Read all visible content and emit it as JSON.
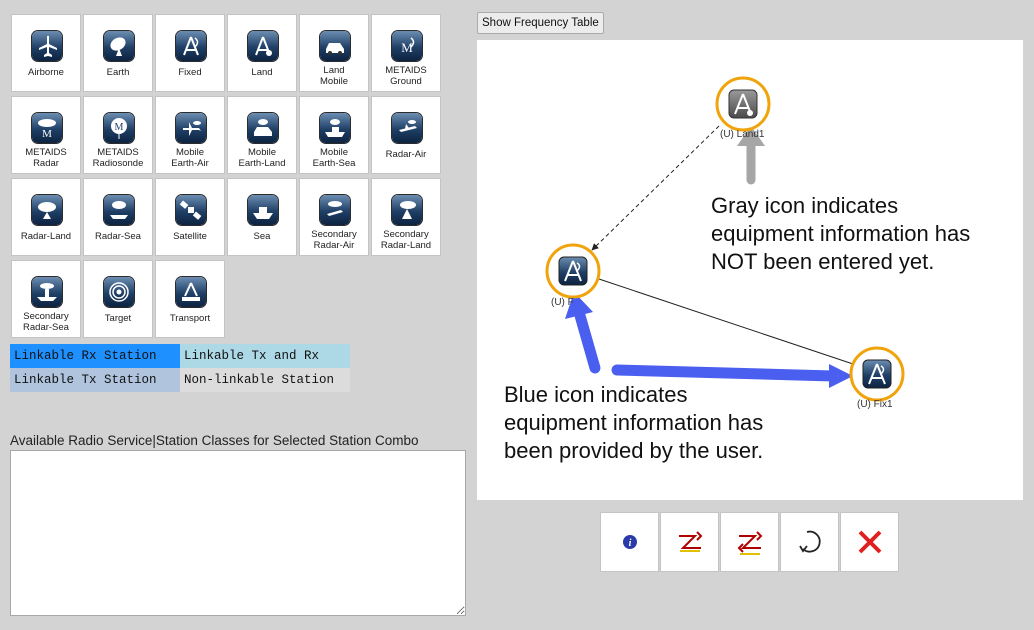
{
  "palette": {
    "stations": [
      {
        "label": "Airborne",
        "icon": "airplane-icon"
      },
      {
        "label": "Earth",
        "icon": "satellite-dish-icon"
      },
      {
        "label": "Fixed",
        "icon": "fixed-tower-icon"
      },
      {
        "label": "Land",
        "icon": "land-tower-icon"
      },
      {
        "label": "Land\nMobile",
        "icon": "car-icon"
      },
      {
        "label": "METAIDS\nGround",
        "icon": "metaids-ground-icon"
      },
      {
        "label": "METAIDS\nRadar",
        "icon": "metaids-radar-icon"
      },
      {
        "label": "METAIDS\nRadiosonde",
        "icon": "radiosonde-balloon-icon"
      },
      {
        "label": "Mobile\nEarth-Air",
        "icon": "mobile-earth-air-icon"
      },
      {
        "label": "Mobile\nEarth-Land",
        "icon": "mobile-earth-land-icon"
      },
      {
        "label": "Mobile\nEarth-Sea",
        "icon": "mobile-earth-sea-icon"
      },
      {
        "label": "Radar-Air",
        "icon": "radar-air-icon"
      },
      {
        "label": "Radar-Land",
        "icon": "radar-land-icon"
      },
      {
        "label": "Radar-Sea",
        "icon": "radar-sea-icon"
      },
      {
        "label": "Satellite",
        "icon": "satellite-icon"
      },
      {
        "label": "Sea",
        "icon": "ship-icon"
      },
      {
        "label": "Secondary\nRadar-Air",
        "icon": "secondary-radar-air-icon"
      },
      {
        "label": "Secondary\nRadar-Land",
        "icon": "secondary-radar-land-icon"
      },
      {
        "label": "Secondary\nRadar-Sea",
        "icon": "secondary-radar-sea-icon"
      },
      {
        "label": "Target",
        "icon": "target-icon"
      },
      {
        "label": "Transport",
        "icon": "transport-icon"
      }
    ]
  },
  "legend": {
    "rx": {
      "label": "Linkable Rx Station",
      "color": "#1e90ff"
    },
    "txrx": {
      "label": "Linkable Tx and Rx",
      "color": "#add8e6"
    },
    "tx": {
      "label": "Linkable Tx Station",
      "color": "#b0c4de"
    },
    "none": {
      "label": "Non-linkable Station",
      "color": "#dcdcdc"
    }
  },
  "available": {
    "label": "Available Radio Service|Station Classes for Selected Station Combo",
    "value": ""
  },
  "frequency_button": "Show Frequency Table",
  "canvas": {
    "nodes": [
      {
        "id": "land",
        "label": "(U) Land1",
        "state": "gray"
      },
      {
        "id": "fixed-a",
        "label": "(U) F",
        "state": "blue"
      },
      {
        "id": "fixed-b",
        "label": "(U) Fix1",
        "state": "blue"
      }
    ],
    "gray_note": "Gray icon indicates\nequipment information has\nNOT been entered yet.",
    "blue_note": "Blue icon indicates\nequipment information has\nbeen provided by the user."
  },
  "colors": {
    "highlight_ring": "#f0a30a",
    "blue_arrow": "#4a5ef0",
    "gray_arrow": "#a6a6a6",
    "delete_red": "#e02020"
  },
  "toolbar": {
    "buttons": [
      {
        "name": "info-button",
        "icon": "info-icon"
      },
      {
        "name": "link-button",
        "icon": "link-icon"
      },
      {
        "name": "link-both-button",
        "icon": "link-both-icon"
      },
      {
        "name": "rotate-button",
        "icon": "rotate-icon"
      },
      {
        "name": "delete-button",
        "icon": "delete-icon"
      }
    ]
  }
}
